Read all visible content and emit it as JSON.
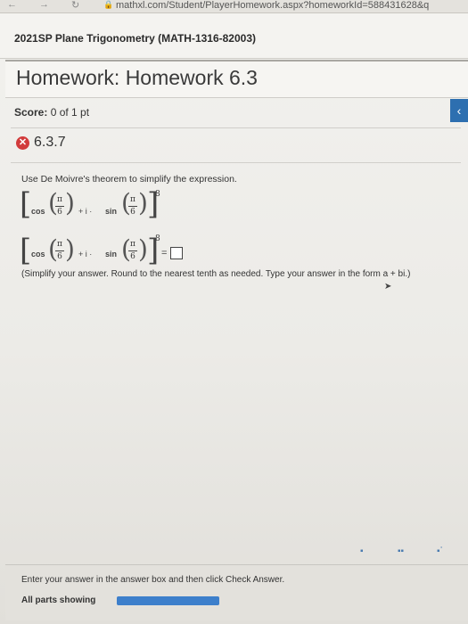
{
  "browser": {
    "url": "mathxl.com/Student/PlayerHomework.aspx?homeworkId=588431628&q"
  },
  "course": {
    "title": "2021SP Plane Trigonometry (MATH-1316-82003)"
  },
  "homework": {
    "title": "Homework: Homework 6.3"
  },
  "score": {
    "label": "Score:",
    "value": "0 of 1 pt"
  },
  "question": {
    "number": "6.3.7",
    "status": "incorrect"
  },
  "instruction": "Use De Moivre's theorem to simplify the expression.",
  "expression": {
    "cos": "cos",
    "sin": "sin",
    "plus_i": "+ i ·",
    "pi": "π",
    "denominator": "6",
    "exponent": "8",
    "equals": "="
  },
  "hint": "(Simplify your answer. Round to the nearest tenth as needed. Type your answer in the form a + bi.)",
  "footer": {
    "message": "Enter your answer in the answer box and then click Check Answer.",
    "parts_label": "All parts showing",
    "progress": 1.0
  },
  "colors": {
    "accent": "#2d6fb0",
    "incorrect": "#d23b3b",
    "progress": "#3d7fcb"
  }
}
